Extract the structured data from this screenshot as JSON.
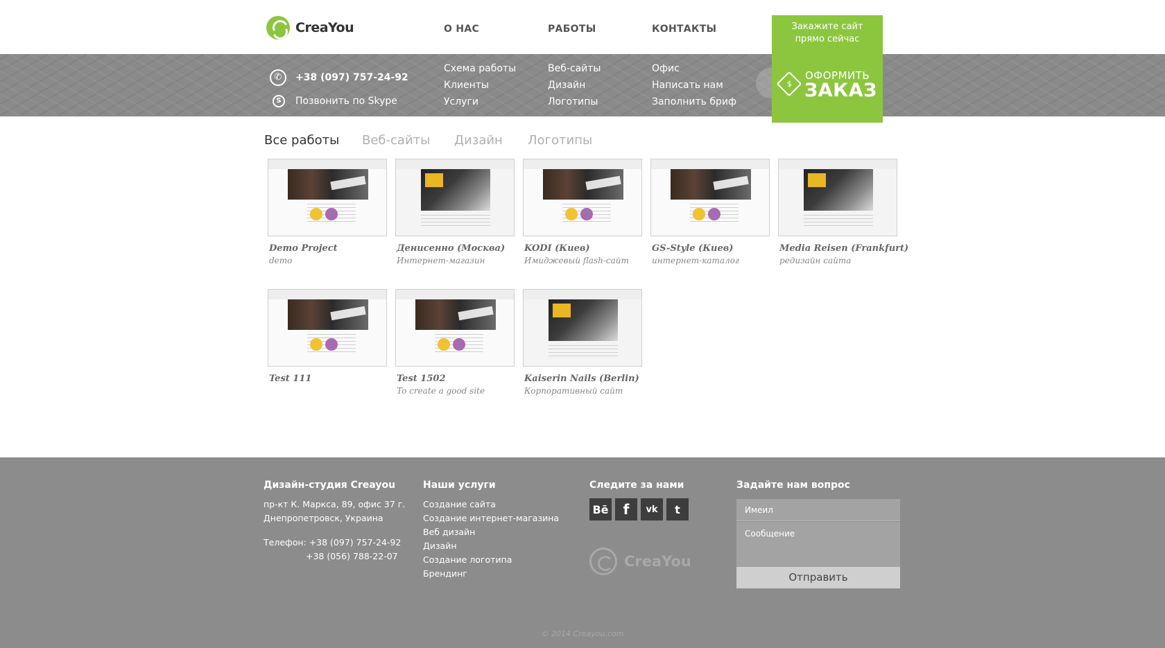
{
  "header": {
    "logo_text": "CreaYou",
    "nav": [
      "О НАС",
      "РАБОТЫ",
      "КОНТАКТЫ"
    ],
    "cta_top": [
      "Закажите сайт",
      "прямо сейчас"
    ]
  },
  "band": {
    "phone": "+38 (097) 757-24-92",
    "skype": "Позвонить по Skype",
    "col1": [
      "Схема работы",
      "Клиенты",
      "Услуги"
    ],
    "col2": [
      "Веб-сайты",
      "Дизайн",
      "Логотипы"
    ],
    "col3": [
      "Офис",
      "Написать нам",
      "Заполнить бриф"
    ],
    "cta": {
      "line1": "ОФОРМИТЬ",
      "line2": "ЗАКАЗ"
    }
  },
  "filters": [
    "Все работы",
    "Веб-сайты",
    "Дизайн",
    "Логотипы"
  ],
  "portfolio": [
    {
      "title": "Demo Project",
      "subtitle": "demo",
      "variant": "v1"
    },
    {
      "title": "Денисенно (Москва)",
      "subtitle": "Интернет-магазин",
      "variant": "v2"
    },
    {
      "title": "KODI (Киев)",
      "subtitle": "Имиджевый flash-сайт",
      "variant": "v1"
    },
    {
      "title": "GS-Style (Киев)",
      "subtitle": "интернет-каталог",
      "variant": "v1"
    },
    {
      "title": "Media Reisen (Frankfurt)",
      "subtitle": "редизайн сайта",
      "variant": "v2"
    },
    {
      "title": "Test 111",
      "subtitle": "",
      "variant": "v1"
    },
    {
      "title": "Test 1502",
      "subtitle": "To create a good site",
      "variant": "v1"
    },
    {
      "title": "Kaiserin Nails (Berlin)",
      "subtitle": "Корпоративный сайт",
      "variant": "v2"
    }
  ],
  "footer": {
    "studio": {
      "heading": "Дизайн-студия Creayou",
      "address1": "пр-кт К. Маркса, 89, офис 37 г.",
      "address2": "Днепропетровск, Украина",
      "phone_label": "Телефон: +38 (097) 757-24-92",
      "phone2": "+38 (056) 788-22-07"
    },
    "services": {
      "heading": "Наши услуги",
      "items": [
        "Создание сайта",
        "Создание интернет-магазина",
        "Веб дизайн",
        "Дизайн",
        "Создание логотипа",
        "Брендинг"
      ]
    },
    "follow": {
      "heading": "Следите за нами",
      "icons": [
        "Bē",
        "f",
        "vk",
        "t"
      ],
      "logo_text": "CreaYou"
    },
    "ask": {
      "heading": "Задайте нам вопрос",
      "email_placeholder": "Имеил",
      "message_placeholder": "Сообщение",
      "send_label": "Отправить"
    },
    "copyright": "© 2014 Creayou.com"
  }
}
